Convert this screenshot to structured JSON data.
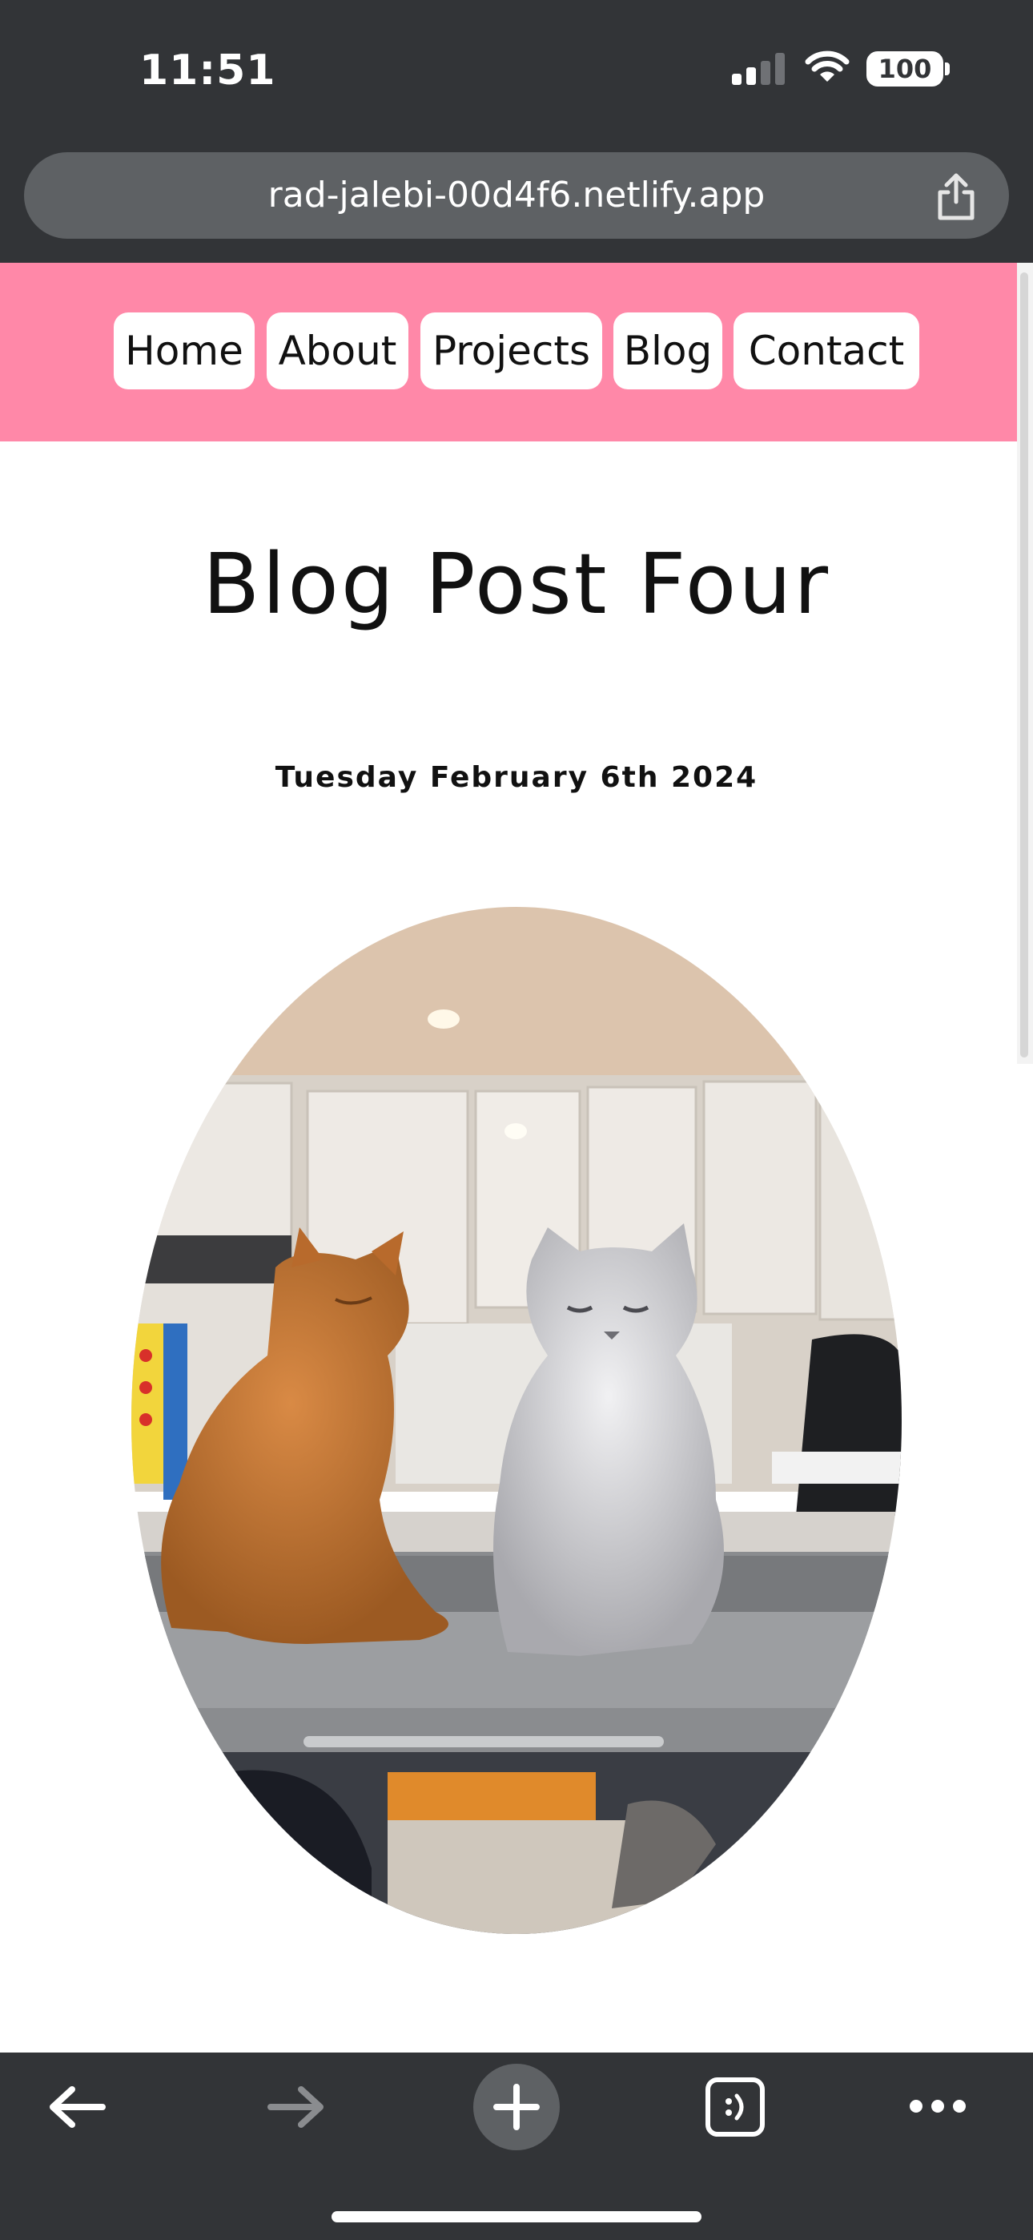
{
  "status_bar": {
    "time": "11:51",
    "battery": "100",
    "icons": [
      "cellular-signal-icon",
      "wifi-icon",
      "battery-icon"
    ]
  },
  "browser": {
    "url": "rad-jalebi-00d4f6.netlify.app",
    "icons": [
      "share-icon",
      "back-arrow-icon",
      "forward-arrow-icon",
      "new-tab-plus-icon",
      "tabs-icon",
      "more-menu-icon"
    ]
  },
  "nav": {
    "items": [
      {
        "label": "Home"
      },
      {
        "label": "About"
      },
      {
        "label": "Projects"
      },
      {
        "label": "Blog"
      },
      {
        "label": "Contact"
      }
    ]
  },
  "post": {
    "title": "Blog Post Four",
    "date": "Tuesday February 6th 2024"
  },
  "colors": {
    "chrome": "#323437",
    "urlbar": "#5e6164",
    "nav_background": "#ff88a8",
    "nav_button": "#ffffff",
    "text": "#111111"
  }
}
